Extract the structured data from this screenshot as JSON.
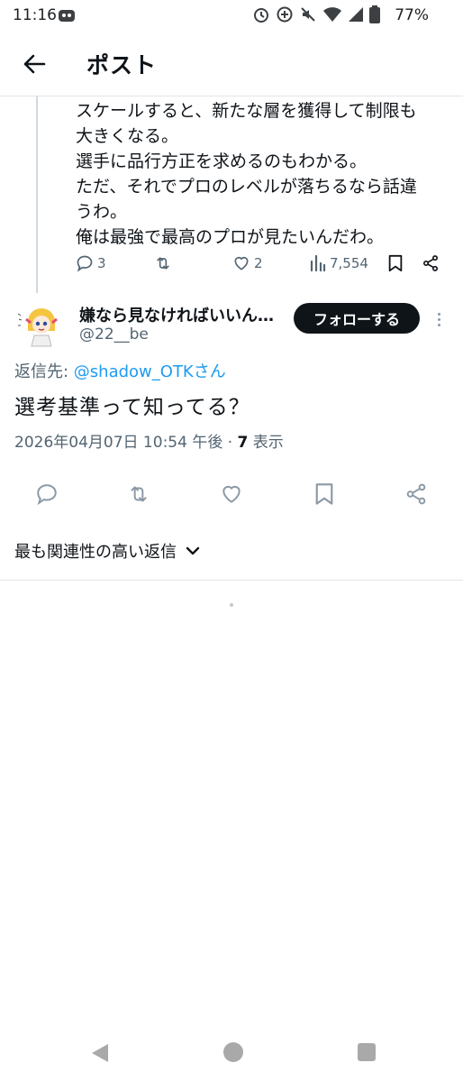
{
  "status_bar": {
    "time": "11:16",
    "battery": "77%"
  },
  "header": {
    "title": "ポスト"
  },
  "parent_tweet": {
    "text": "スケールすると、新たな層を獲得して制限も\n大きくなる。\n選手に品行方正を求めるのもわかる。\nただ、それでプロのレベルが落ちるなら話違\nうわ。\n俺は最強で最高のプロが見たいんだわ。",
    "reply_count": "3",
    "like_count": "2",
    "view_count": "7,554"
  },
  "reply_tweet": {
    "display_name": "嫌なら見なければいいんだよ",
    "handle": "@22__be",
    "follow_label": "フォローする",
    "reply_to_prefix": "返信先: ",
    "reply_to_mention": "@shadow_OTKさん",
    "text": "選考基準って知ってる？",
    "timestamp": "2026年04月07日 10:54 午後 · ",
    "views_count": "7",
    "views_label": " 表示"
  },
  "replies_sort": {
    "label": "最も関連性の高い返信"
  },
  "colors": {
    "accent": "#1d9bf0",
    "text_primary": "#0f1419",
    "text_secondary": "#536471",
    "follow_bg": "#0f1419"
  },
  "icons": {
    "back": "arrow-left-icon",
    "reply": "comment-icon",
    "retweet": "retweet-icon",
    "like": "heart-icon",
    "views": "bar-chart-icon",
    "bookmark": "bookmark-icon",
    "share": "share-icon",
    "more": "more-vertical-icon",
    "chevron": "chevron-down-icon"
  }
}
